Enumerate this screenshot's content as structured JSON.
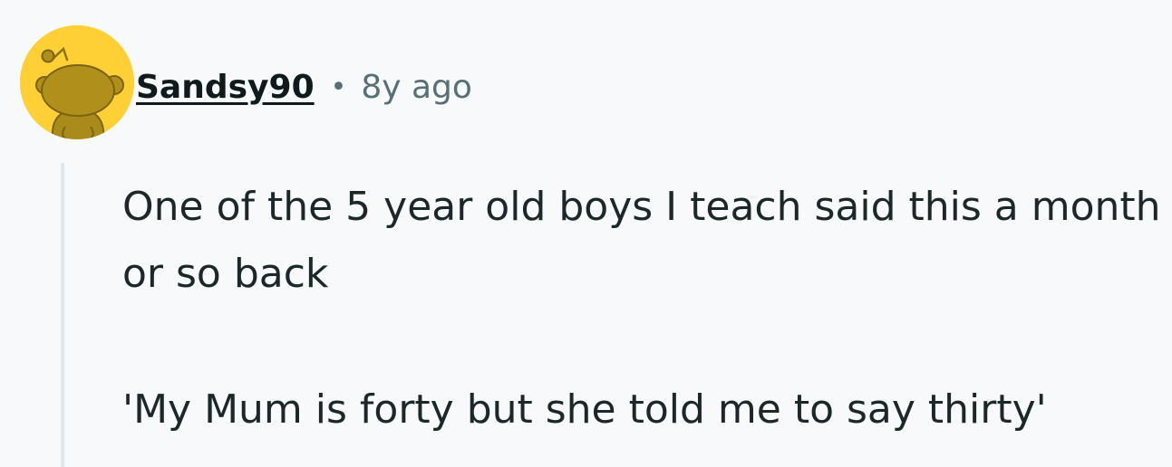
{
  "comment": {
    "username": "Sandsy90",
    "separator": "•",
    "timestamp": "8y ago",
    "avatar_icon": "snoo-avatar-icon",
    "avatar_background": "#ffd035",
    "paragraphs": [
      "One of the 5 year old boys I teach said this a month or so back",
      "'My Mum is forty but she told me to say thirty'"
    ]
  }
}
